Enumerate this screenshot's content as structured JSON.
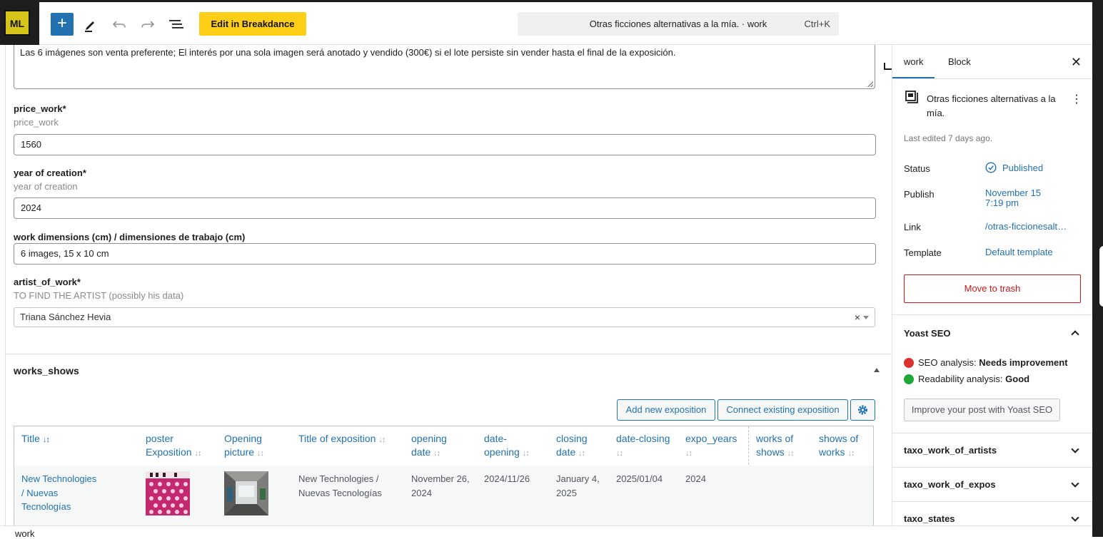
{
  "toolbar": {
    "add_icon": "plus-icon",
    "edit_bd_label": "Edit in Breakdance",
    "command_title": "Otras ficciones alternativas a la mía. · work",
    "command_shortcut": "Ctrl+K"
  },
  "form": {
    "notes_value": "Las 6 imágenes son venta preferente; El interés por una sola imagen será anotado y vendido (300€) si el lote persiste sin vender hasta el final de la exposición.",
    "price": {
      "label": "price_work*",
      "hint": "price_work",
      "value": "1560"
    },
    "year": {
      "label": "year of creation*",
      "hint": "year of creation",
      "value": "2024"
    },
    "dimensions": {
      "label": "work dimensions (cm) / dimensiones de trabajo (cm)",
      "value": "6 images, 15 x 10 cm"
    },
    "artist": {
      "label": "artist_of_work*",
      "hint": "TO FIND THE ARTIST (possibly his data)",
      "value": "Triana Sánchez Hevia",
      "clear": "×"
    }
  },
  "works_shows": {
    "title": "works_shows",
    "add_button": "Add new exposition",
    "connect_button": "Connect existing exposition",
    "columns": [
      {
        "line1": "Title",
        "line2": ""
      },
      {
        "line1": "poster",
        "line2": "Exposition"
      },
      {
        "line1": "Opening",
        "line2": "picture"
      },
      {
        "line1": "Title of exposition",
        "line2": ""
      },
      {
        "line1": "opening",
        "line2": "date"
      },
      {
        "line1": "date-",
        "line2": "opening"
      },
      {
        "line1": "closing",
        "line2": "date"
      },
      {
        "line1": "date-closing",
        "line2": ""
      },
      {
        "line1": "expo_years",
        "line2": ""
      },
      {
        "line1": "works of",
        "line2": "shows"
      },
      {
        "line1": "shows of",
        "line2": "works"
      }
    ],
    "row": {
      "title_lines": [
        "New Technologies",
        "/ Nuevas",
        "Tecnologías"
      ],
      "expo_title_lines": [
        "New Technologies /",
        "Nuevas Tecnologías"
      ],
      "opening_date_lines": [
        "November 26,",
        "2024"
      ],
      "date_opening": "2024/11/26",
      "closing_date_lines": [
        "January 4,",
        "2025"
      ],
      "date_closing": "2025/01/04",
      "expo_years": "2024"
    }
  },
  "footer": {
    "breadcrumb": "work"
  },
  "sidebar": {
    "tab_work": "work",
    "tab_block": "Block",
    "close": "✕",
    "post_title": "Otras ficciones alternativas a la mía.",
    "kebab": "⋮",
    "last_edited": "Last edited 7 days ago.",
    "status_label": "Status",
    "status_value": "Published",
    "publish_label": "Publish",
    "publish_value_line1": "November 15",
    "publish_value_line2": "7:19 pm",
    "link_label": "Link",
    "link_value": "/otras-ficcionesalt…",
    "template_label": "Template",
    "template_value": "Default template",
    "trash_label": "Move to trash",
    "yoast": {
      "title": "Yoast SEO",
      "seo_label": "SEO analysis:",
      "seo_value": "Needs improvement",
      "read_label": "Readability analysis:",
      "read_value": "Good",
      "improve_button": "Improve your post with Yoast SEO"
    },
    "panels": [
      "taxo_work_of_artists",
      "taxo_work_of_expos",
      "taxo_states"
    ]
  },
  "colors": {
    "accent": "#2271b1",
    "brand_yellow": "#ffcf18",
    "danger": "#cc1818"
  }
}
